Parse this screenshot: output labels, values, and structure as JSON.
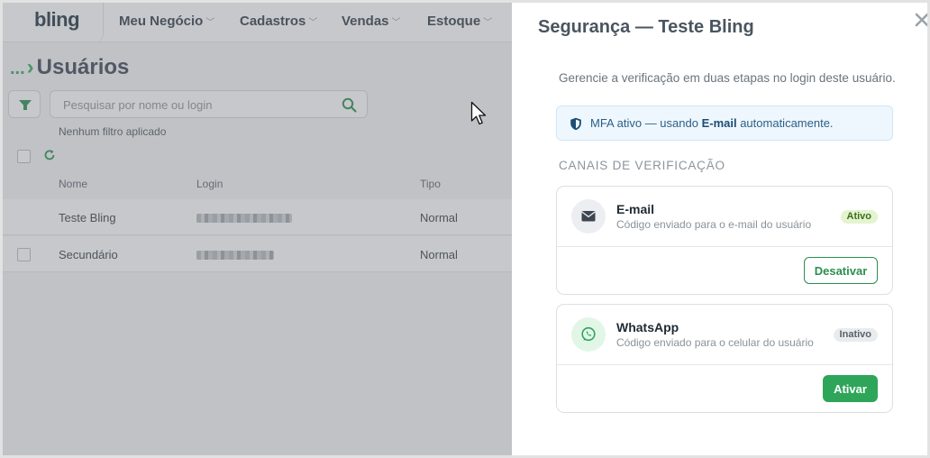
{
  "app": {
    "logo": "bling",
    "nav": [
      "Meu Negócio",
      "Cadastros",
      "Vendas",
      "Estoque"
    ]
  },
  "page": {
    "breadcrumb_dots": "...",
    "title": "Usuários"
  },
  "search": {
    "placeholder": "Pesquisar por nome ou login",
    "value": ""
  },
  "filter_status": "Nenhum filtro aplicado",
  "table": {
    "headers": [
      "Nome",
      "Login",
      "Tipo"
    ],
    "rows": [
      {
        "name": "Teste Bling",
        "type": "Normal"
      },
      {
        "name": "Secundário",
        "type": "Normal"
      }
    ]
  },
  "drawer": {
    "title": "Segurança — Teste Bling",
    "description": "Gerencie a verificação em duas etapas no login deste usuário.",
    "info": {
      "prefix": "MFA ativo — usando ",
      "method": "E-mail",
      "suffix": " automaticamente."
    },
    "section_heading": "CANAIS DE VERIFICAÇÃO",
    "channels": [
      {
        "name": "E-mail",
        "description": "Código enviado para o e-mail do usuário",
        "status": "Ativo",
        "action": "Desativar",
        "icon": "envelope-icon"
      },
      {
        "name": "WhatsApp",
        "description": "Código enviado para o celular do usuário",
        "status": "Inativo",
        "action": "Ativar",
        "icon": "whatsapp-icon"
      }
    ]
  },
  "colors": {
    "accent": "#2fa55a",
    "info_bg": "#eef7fd",
    "badge_active": "#e3f4cf"
  }
}
